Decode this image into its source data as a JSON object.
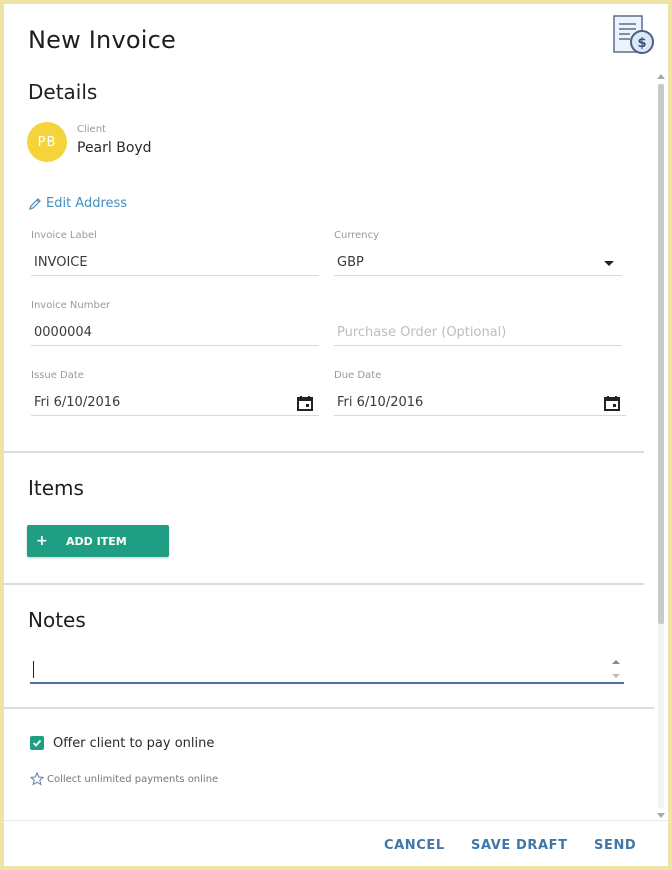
{
  "dialog": {
    "title": "New Invoice",
    "icon": "invoice-dollar-icon"
  },
  "details": {
    "heading": "Details",
    "client": {
      "caption": "Client",
      "initials": "PB",
      "name": "Pearl Boyd",
      "avatar_color": "#f5d33a"
    },
    "edit_address": "Edit Address",
    "invoice_label": {
      "caption": "Invoice Label",
      "value": "INVOICE"
    },
    "currency": {
      "caption": "Currency",
      "value": "GBP"
    },
    "invoice_number": {
      "caption": "Invoice Number",
      "value": "0000004"
    },
    "purchase_order": {
      "placeholder": "Purchase Order (Optional)"
    },
    "issue_date": {
      "caption": "Issue Date",
      "value": "Fri 6/10/2016"
    },
    "due_date": {
      "caption": "Due Date",
      "value": "Fri 6/10/2016"
    }
  },
  "items": {
    "heading": "Items",
    "add_button": "ADD ITEM"
  },
  "notes": {
    "heading": "Notes",
    "value": ""
  },
  "payment": {
    "offer_online_label": "Offer client to pay online",
    "offer_online_checked": true,
    "upsell": "Collect unlimited payments online"
  },
  "footer": {
    "cancel": "CANCEL",
    "save_draft": "SAVE DRAFT",
    "send": "SEND"
  },
  "colors": {
    "accent": "#1f9e84",
    "link": "#3f8fbf",
    "footer_button": "#3f78a8",
    "notes_underline": "#4a6fa5"
  }
}
